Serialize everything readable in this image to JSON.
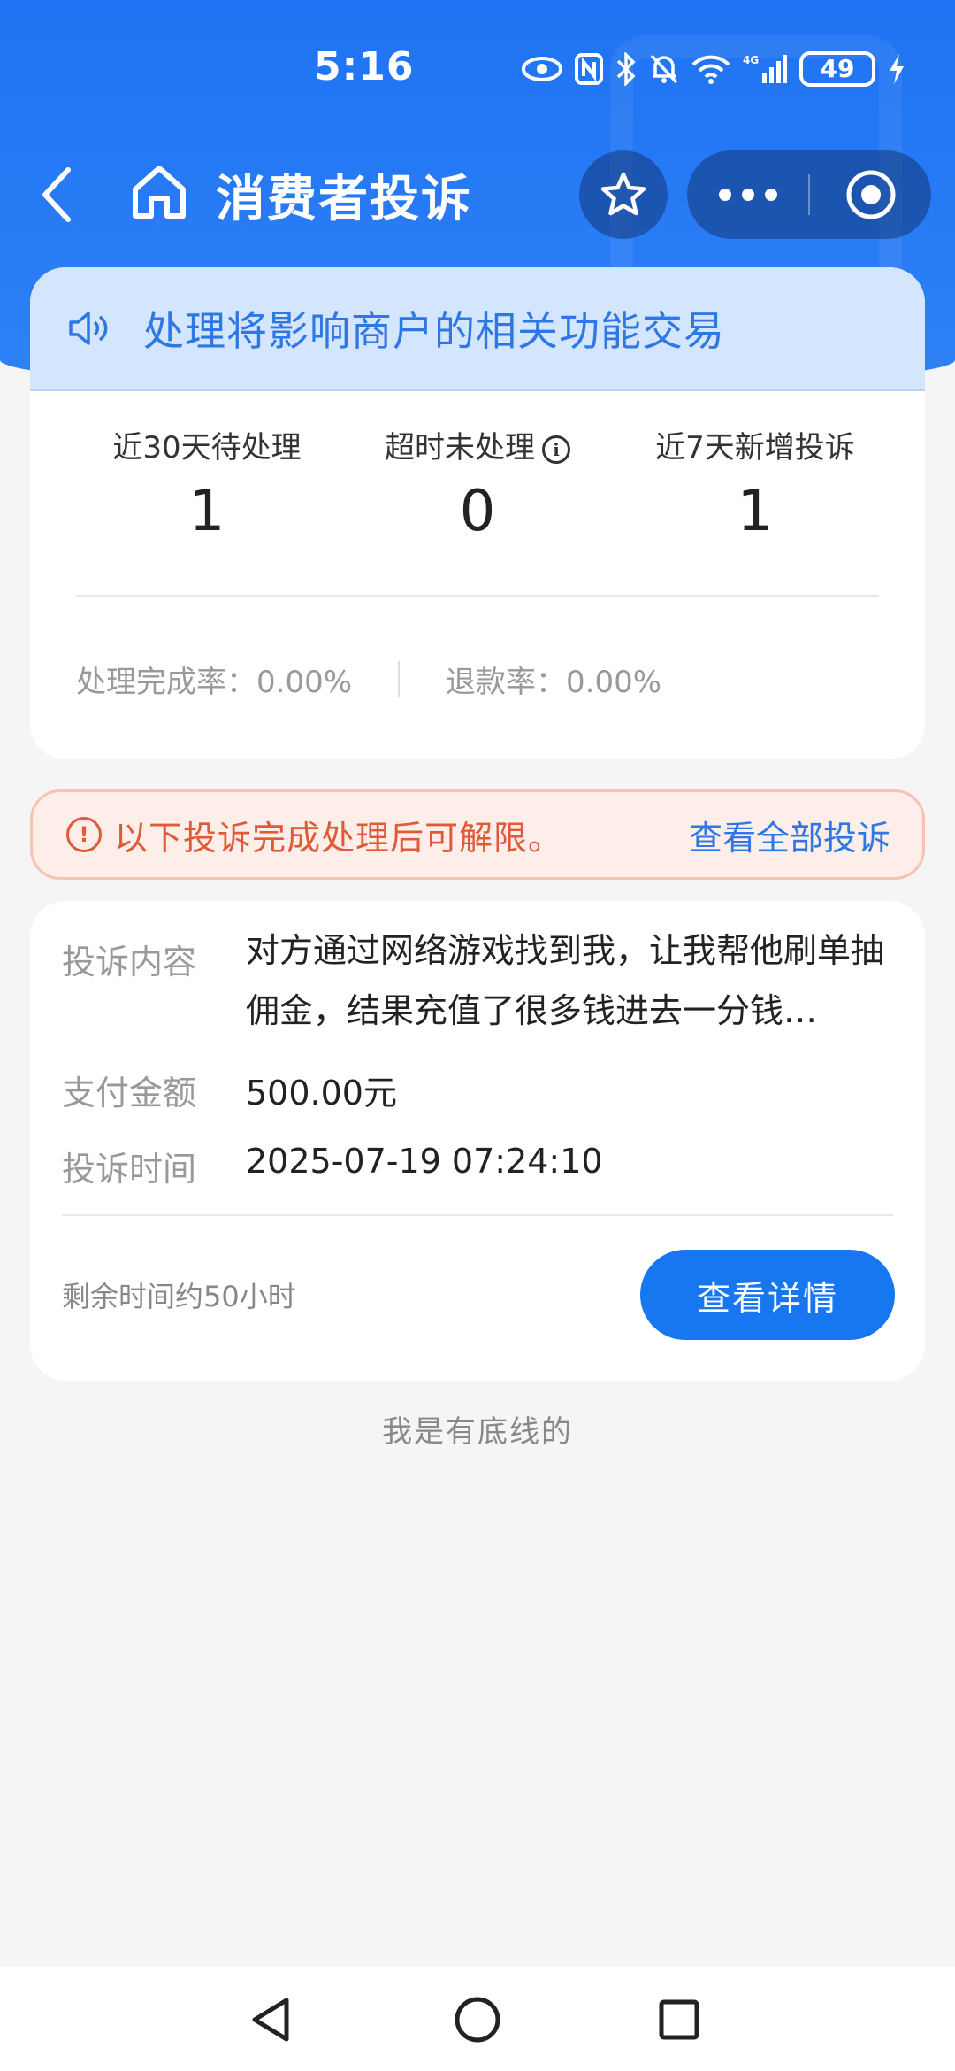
{
  "status_bar": {
    "time": "5:16",
    "network": "4G",
    "battery": "49",
    "icons": [
      "eye-icon",
      "nfc-icon",
      "bluetooth-icon",
      "mute-bell-icon",
      "wifi-icon",
      "signal-icon",
      "battery-icon",
      "charging-icon"
    ]
  },
  "nav": {
    "title": "消费者投诉"
  },
  "notice": {
    "text": "处理将影响商户的相关功能交易"
  },
  "stats": {
    "pending_label": "近30天待处理",
    "pending_value": "1",
    "overdue_label": "超时未处理",
    "overdue_value": "0",
    "new_label": "近7天新增投诉",
    "new_value": "1"
  },
  "rates": {
    "completion": "处理完成率：0.00%",
    "refund": "退款率：0.00%"
  },
  "alert": {
    "text": "以下投诉完成处理后可解限。",
    "link": "查看全部投诉"
  },
  "complaint": {
    "content_label": "投诉内容",
    "content_value": "对方通过网络游戏找到我，让我帮他刷单抽佣金，结果充值了很多钱进去一分钱…",
    "amount_label": "支付金额",
    "amount_value": "500.00元",
    "time_label": "投诉时间",
    "time_value": "2025-07-19 07:24:10",
    "remaining": "剩余时间约50小时",
    "detail_button": "查看详情"
  },
  "footer": {
    "text": "我是有底线的"
  },
  "colors": {
    "brand_blue": "#1f73f2",
    "button_blue": "#1677f0",
    "alert_orange": "#e15a38",
    "link_blue": "#2f78e3"
  }
}
